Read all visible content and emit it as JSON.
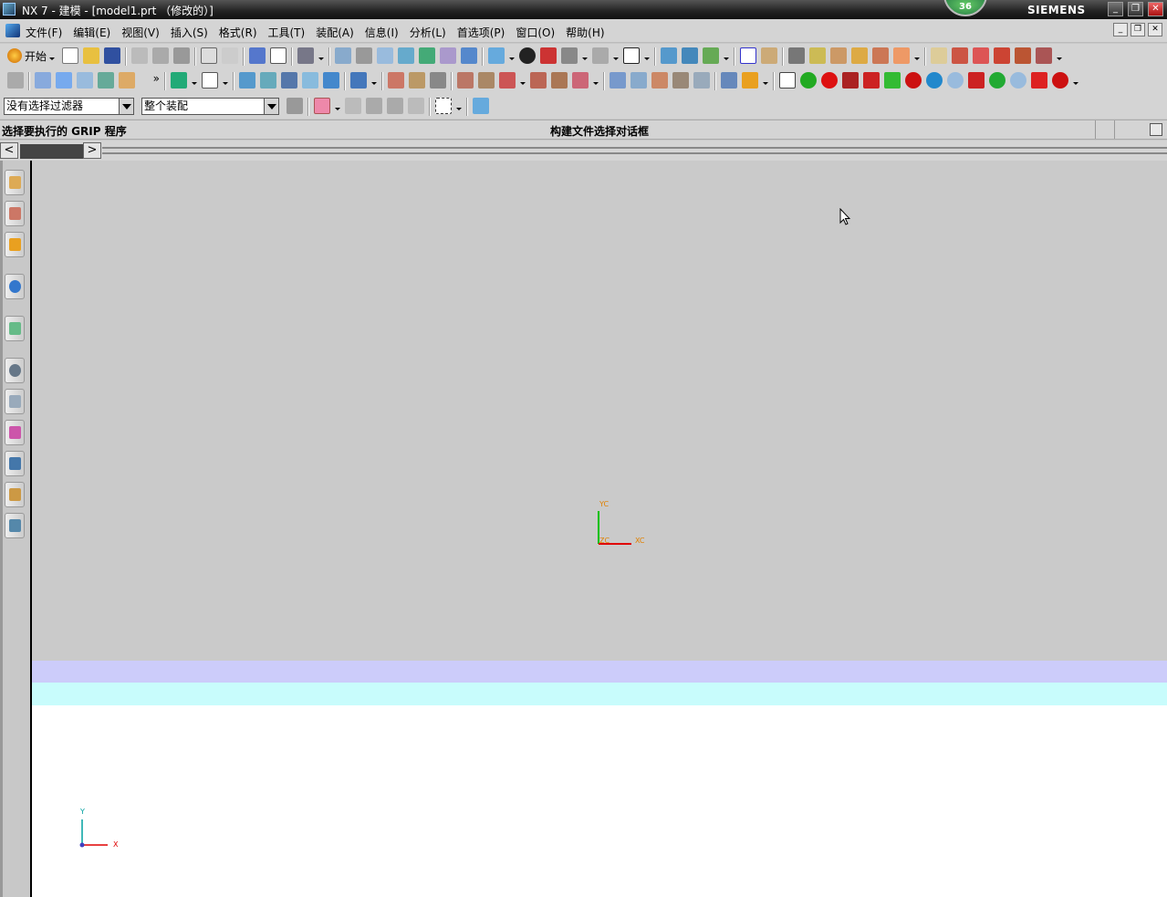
{
  "window": {
    "title": "NX 7 - 建模 - [model1.prt （修改的）]",
    "brand": "SIEMENS",
    "badge": "36"
  },
  "menubar": {
    "items": [
      "文件(F)",
      "编辑(E)",
      "视图(V)",
      "插入(S)",
      "格式(R)",
      "工具(T)",
      "装配(A)",
      "信息(I)",
      "分析(L)",
      "首选项(P)",
      "窗口(O)",
      "帮助(H)"
    ]
  },
  "toolbar": {
    "start_label": "开始"
  },
  "selection": {
    "filter": "没有选择过滤器",
    "scope": "整个装配"
  },
  "cue": {
    "prompt": "选择要执行的 GRIP 程序",
    "status": "构建文件选择对话框"
  },
  "graphics": {
    "wcs_y": "YC",
    "wcs_x": "XC",
    "wcs_z": "ZC",
    "abs_y": "Y",
    "abs_x": "X"
  },
  "colors": {
    "background": "#cacaca",
    "band_blue": "#ccccfa",
    "band_cyan": "#c8fcfc",
    "axis_x": "#e00000",
    "axis_y": "#00c000",
    "label_orange": "#e08000"
  }
}
